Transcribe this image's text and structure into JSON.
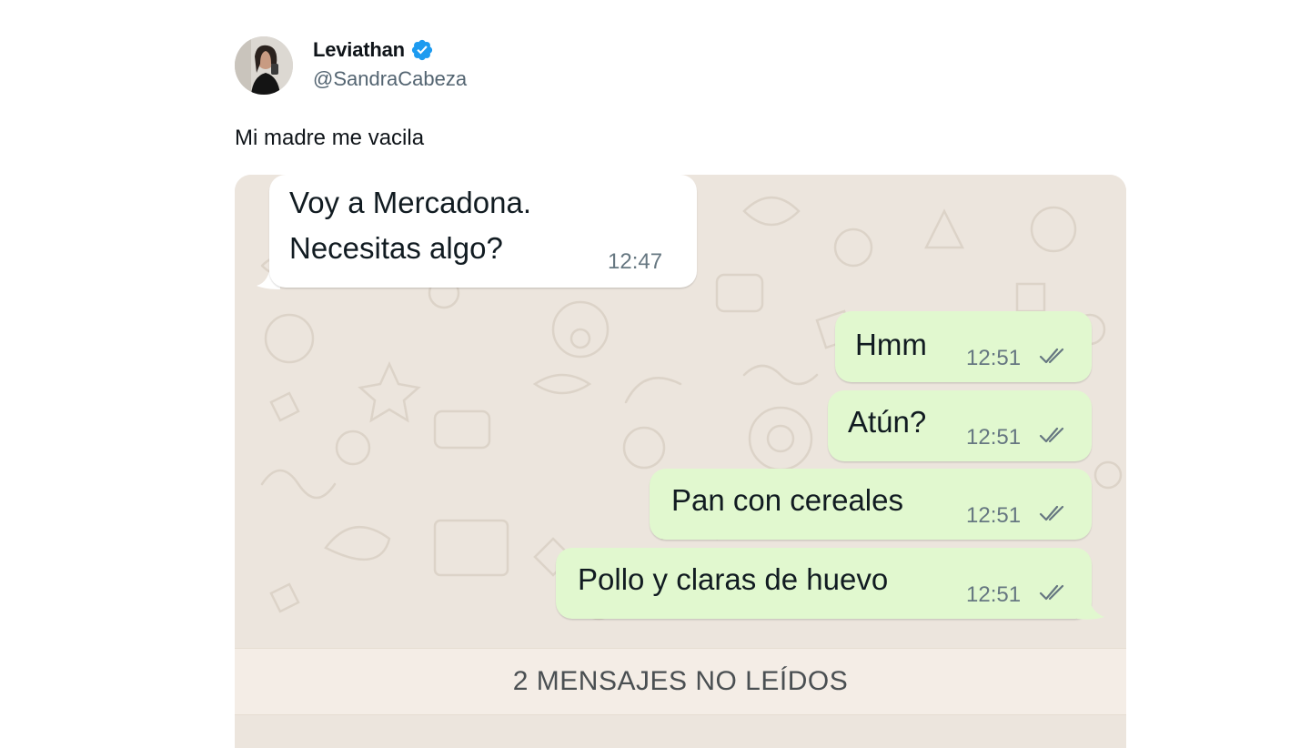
{
  "author": {
    "name": "Leviathan",
    "handle": "@SandraCabeza",
    "verified": true
  },
  "tweet": {
    "text": "Mi madre me vacila"
  },
  "chat": {
    "incoming": {
      "line1": "Voy a Mercadona.",
      "line2": "Necesitas algo?",
      "time": "12:47"
    },
    "outgoing": [
      {
        "text": "Hmm",
        "time": "12:51"
      },
      {
        "text": "Atún?",
        "time": "12:51"
      },
      {
        "text": "Pan con cereales",
        "time": "12:51"
      },
      {
        "text": "Pollo y claras de huevo",
        "time": "12:51"
      }
    ],
    "unread_banner": "2 MENSAJES NO LEÍDOS"
  },
  "colors": {
    "wallpaper": "#ece5dd",
    "outgoing_bubble": "#e1f8cf",
    "incoming_bubble": "#ffffff",
    "verified_badge": "#1d9bf0",
    "read_ticks": "#667781"
  },
  "icons": {
    "verified": "verified-badge-icon",
    "read_status": "double-check-icon"
  }
}
